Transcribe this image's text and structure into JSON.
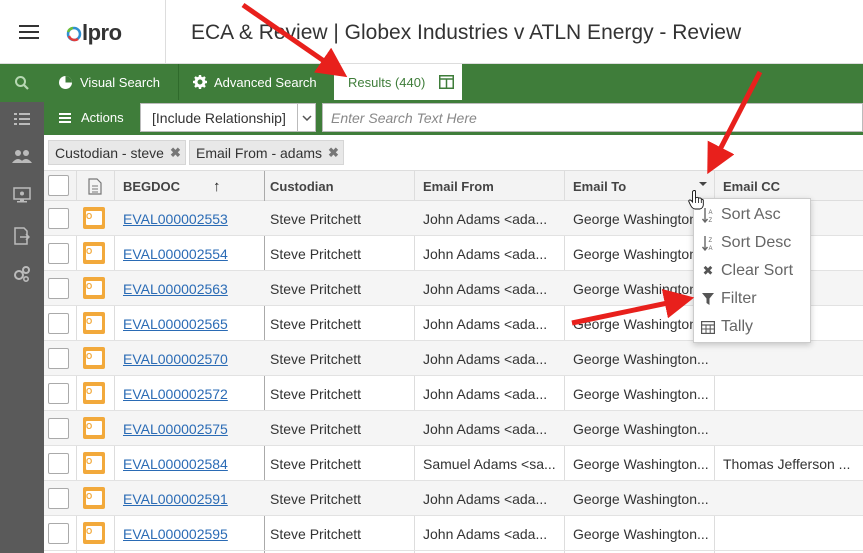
{
  "header": {
    "title": "ECA & Review | Globex Industries v ATLN Energy - Review",
    "logo_text": "lpro"
  },
  "sidebar": {
    "items": [
      "search-icon",
      "list-icon",
      "people-icon",
      "monitor-icon",
      "export-icon",
      "settings-icon"
    ]
  },
  "tabs": [
    {
      "label": "Visual Search",
      "icon": "pie-chart-icon"
    },
    {
      "label": "Advanced Search",
      "icon": "gear-icon"
    },
    {
      "label": "Results (440)",
      "icon": "columns-icon"
    }
  ],
  "actionbar": {
    "actions_label": "Actions",
    "relationship_value": "[Include Relationship]",
    "search_placeholder": "Enter Search Text Here"
  },
  "chips": [
    {
      "label": "Custodian - steve"
    },
    {
      "label": "Email From - adams"
    }
  ],
  "grid": {
    "columns": [
      "BEGDOC",
      "Custodian",
      "Email From",
      "Email To",
      "Email CC"
    ],
    "sort_indicator": "↑",
    "rows": [
      {
        "begdoc": "EVAL000002553",
        "custodian": "Steve Pritchett",
        "from": "John Adams <ada...",
        "to": "George Washington...",
        "cc": ""
      },
      {
        "begdoc": "EVAL000002554",
        "custodian": "Steve Pritchett",
        "from": "John Adams <ada...",
        "to": "George Washington...",
        "cc": ""
      },
      {
        "begdoc": "EVAL000002563",
        "custodian": "Steve Pritchett",
        "from": "John Adams <ada...",
        "to": "George Washington...",
        "cc": ""
      },
      {
        "begdoc": "EVAL000002565",
        "custodian": "Steve Pritchett",
        "from": "John Adams <ada...",
        "to": "George Washington...",
        "cc": ""
      },
      {
        "begdoc": "EVAL000002570",
        "custodian": "Steve Pritchett",
        "from": "John Adams <ada...",
        "to": "George Washington...",
        "cc": ""
      },
      {
        "begdoc": "EVAL000002572",
        "custodian": "Steve Pritchett",
        "from": "John Adams <ada...",
        "to": "George Washington...",
        "cc": ""
      },
      {
        "begdoc": "EVAL000002575",
        "custodian": "Steve Pritchett",
        "from": "John Adams <ada...",
        "to": "George Washington...",
        "cc": ""
      },
      {
        "begdoc": "EVAL000002584",
        "custodian": "Steve Pritchett",
        "from": "Samuel Adams <sa...",
        "to": "George Washington...",
        "cc": "Thomas Jefferson ..."
      },
      {
        "begdoc": "EVAL000002591",
        "custodian": "Steve Pritchett",
        "from": "John Adams <ada...",
        "to": "George Washington...",
        "cc": ""
      },
      {
        "begdoc": "EVAL000002595",
        "custodian": "Steve Pritchett",
        "from": "John Adams <ada...",
        "to": "George Washington...",
        "cc": ""
      }
    ]
  },
  "column_menu": {
    "items": [
      {
        "label": "Sort Asc",
        "icon": "sort-asc-icon"
      },
      {
        "label": "Sort Desc",
        "icon": "sort-desc-icon"
      },
      {
        "label": "Clear Sort",
        "icon": "close-icon"
      },
      {
        "label": "Filter",
        "icon": "filter-icon"
      },
      {
        "label": "Tally",
        "icon": "table-icon"
      }
    ]
  },
  "colors": {
    "brand_green": "#3f7d3a",
    "sidebar_gray": "#5a5a5a",
    "link_blue": "#2a6bb5",
    "annotation_red": "#e8201c",
    "outlook_orange": "#f2a93b"
  }
}
